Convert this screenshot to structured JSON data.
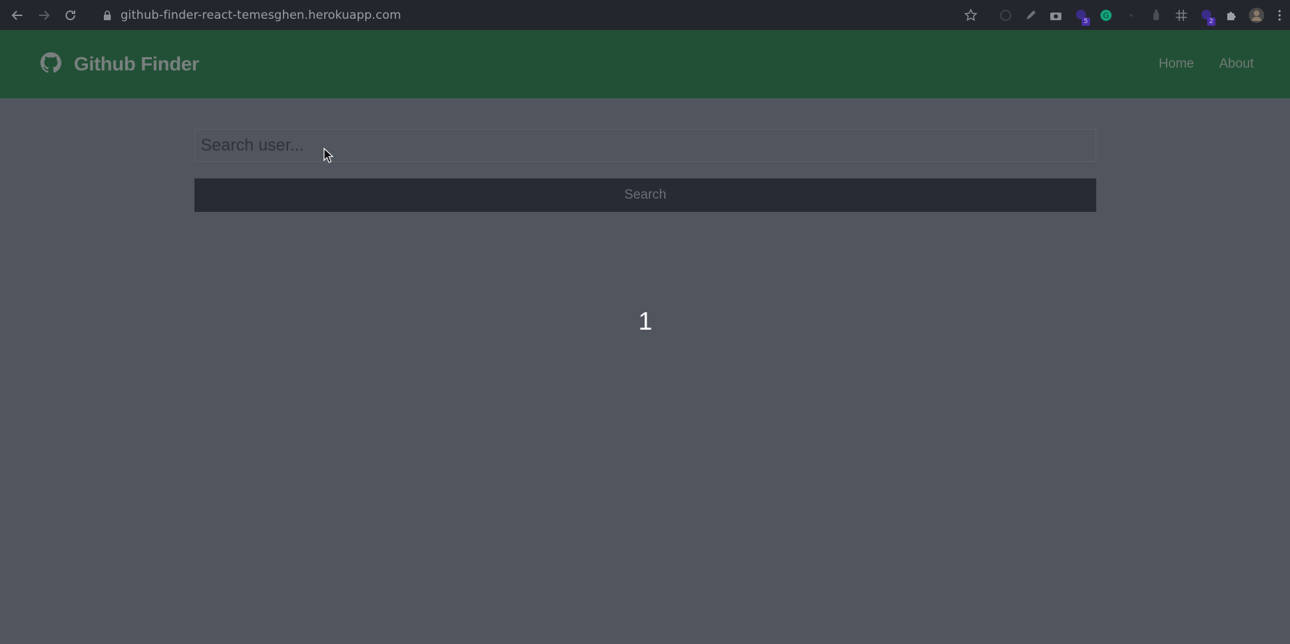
{
  "browser": {
    "url": "github-finder-react-temesghen.herokuapp.com",
    "extension_badges": [
      "5",
      "2"
    ]
  },
  "navbar": {
    "brand_icon": "github-icon",
    "brand_title": "Github Finder",
    "links": [
      {
        "label": "Home"
      },
      {
        "label": "About"
      }
    ],
    "background_color": "#225036"
  },
  "search": {
    "placeholder": "Search user...",
    "value": "",
    "button_label": "Search"
  },
  "overlay": {
    "step_number": "1"
  },
  "colors": {
    "page_background": "#51555e",
    "button_background": "#282b33"
  }
}
